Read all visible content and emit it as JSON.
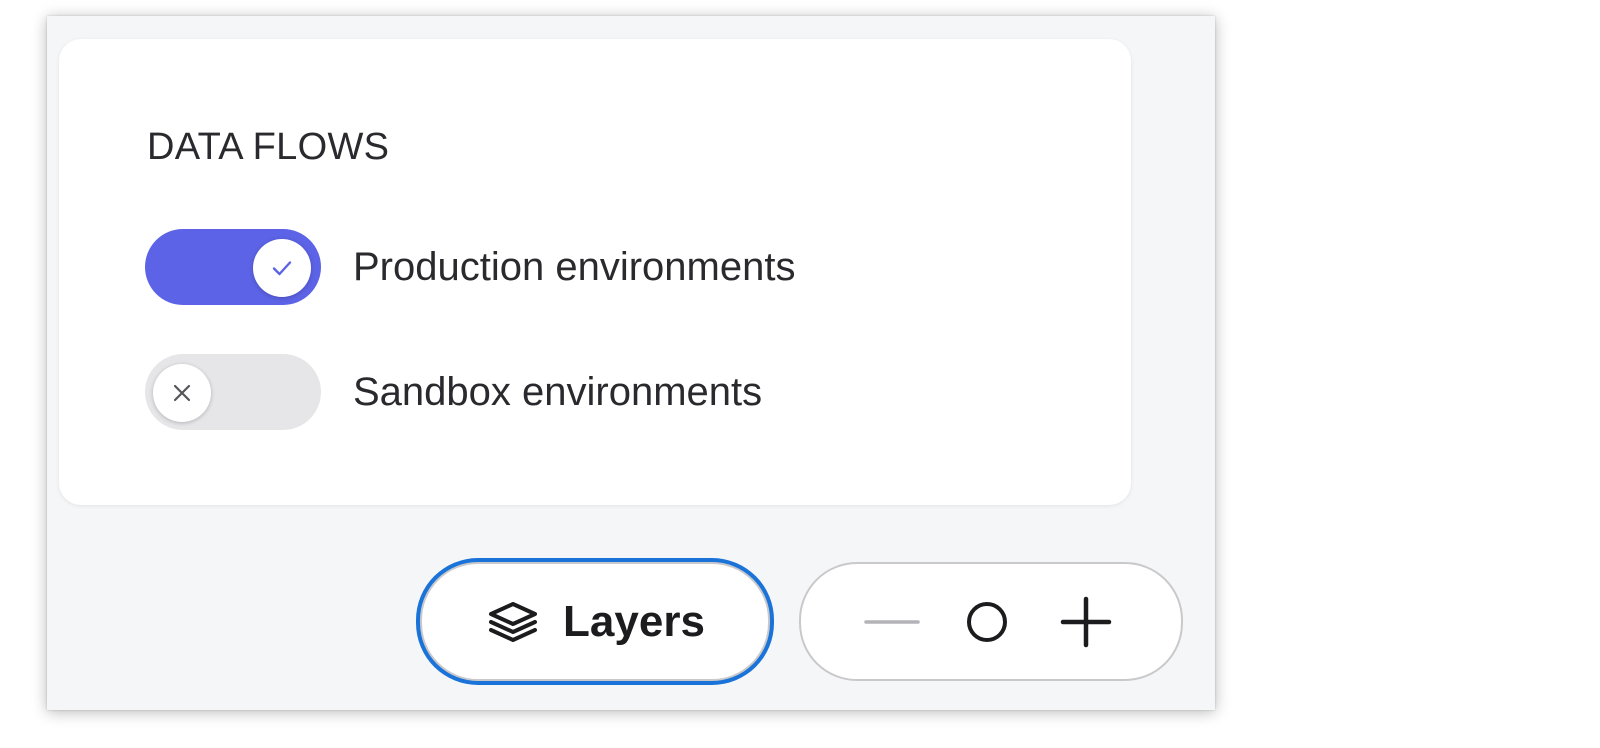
{
  "panel": {
    "title": "DATA FLOWS",
    "toggles": [
      {
        "label": "Production environments",
        "state": "on",
        "icon": "checkmark-icon"
      },
      {
        "label": "Sandbox environments",
        "state": "off",
        "icon": "close-icon"
      }
    ]
  },
  "toolbar": {
    "layers_label": "Layers",
    "layers_icon": "layers-icon",
    "zoom_out_icon": "minus-icon",
    "zoom_reset_icon": "circle-icon",
    "zoom_in_icon": "plus-icon"
  },
  "colors": {
    "accent": "#5c63e6",
    "focus_ring": "#1a73d9",
    "toggle_off": "#e6e6e9"
  }
}
